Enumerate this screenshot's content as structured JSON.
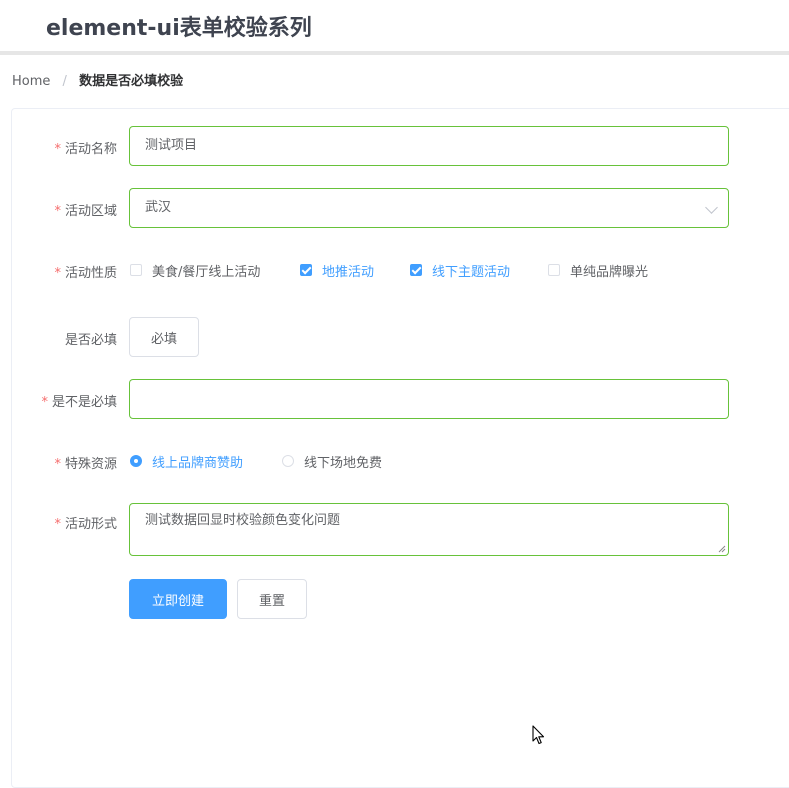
{
  "header": {
    "title": "element-ui表单校验系列"
  },
  "breadcrumb": {
    "home": "Home",
    "separator": "/",
    "current": "数据是否必填校验"
  },
  "form": {
    "required_mark": "*",
    "name": {
      "label": "活动名称",
      "value": "测试项目",
      "required": true
    },
    "region": {
      "label": "活动区域",
      "value": "武汉",
      "required": true,
      "icon": "chevron-down-icon"
    },
    "type": {
      "label": "活动性质",
      "required": true,
      "options": [
        {
          "label": "美食/餐厅线上活动",
          "checked": false
        },
        {
          "label": "地推活动",
          "checked": true
        },
        {
          "label": "线下主题活动",
          "checked": true
        },
        {
          "label": "单纯品牌曝光",
          "checked": false
        }
      ]
    },
    "toggle_required": {
      "label": "是否必填",
      "button": "必填"
    },
    "is_required": {
      "label": "是不是必填",
      "value": "",
      "required": true
    },
    "resource": {
      "label": "特殊资源",
      "required": true,
      "options": [
        {
          "label": "线上品牌商赞助",
          "checked": true
        },
        {
          "label": "线下场地免费",
          "checked": false
        }
      ]
    },
    "desc": {
      "label": "活动形式",
      "value": "测试数据回显时校验颜色变化问题",
      "required": true
    },
    "actions": {
      "submit": "立即创建",
      "reset": "重置"
    }
  },
  "colors": {
    "primary": "#409eff",
    "success_border": "#67c23a",
    "required": "#f56c6c",
    "text": "#606266"
  }
}
